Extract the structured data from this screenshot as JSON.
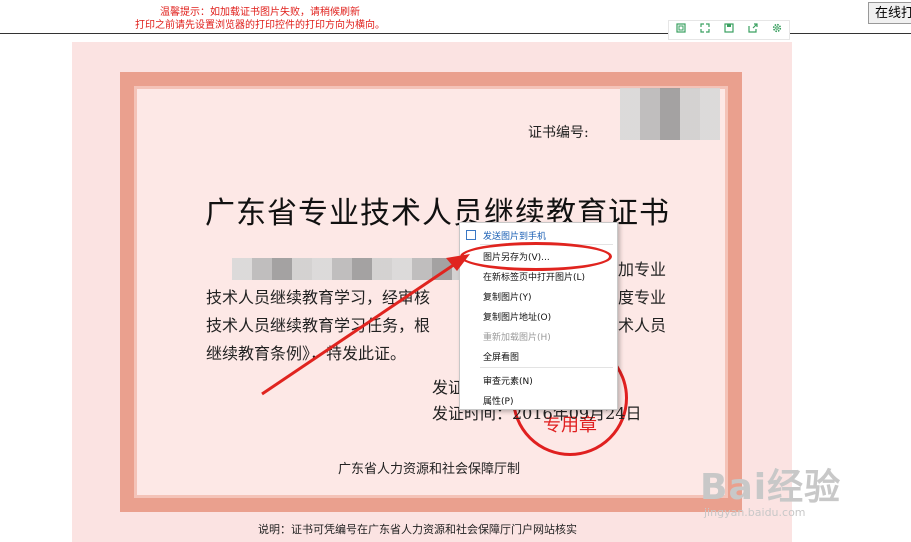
{
  "notice": {
    "line1": "温馨提示：如加载证书图片失败，请稍候刷新",
    "line2": "打印之前请先设置浏览器的打印控件的打印方向为横向。"
  },
  "online_button": "在线打",
  "toolbar": {
    "icons": [
      "fit-icon",
      "fullscreen-icon",
      "save-icon",
      "share-icon",
      "gear-icon"
    ]
  },
  "certificate": {
    "number_label": "证书编号:",
    "title": "广东省专业技术人员继续教育证书",
    "line1_suffix": "加专业",
    "line2_left": "技术人员继续教育学习，经审核",
    "line2_right": "度专业",
    "line3_left": "技术人员继续教育学习任务，根",
    "line3_right": "术人员",
    "line4": "继续教育条例》，特发此证。",
    "issue_unit_fragment": "发证",
    "issue_date": "发证时间：2016年09月24日",
    "stamp_text": "专用章",
    "issuer": "广东省人力资源和社会保障厅制",
    "note": "说明：证书可凭编号在广东省人力资源和社会保障厅门户网站核实"
  },
  "context_menu": {
    "items": [
      {
        "label": "发送图片到手机",
        "style": "blue"
      },
      {
        "label": "图片另存为(V)...",
        "style": "normal"
      },
      {
        "label": "在新标签页中打开图片(L)",
        "style": "normal"
      },
      {
        "label": "复制图片(Y)",
        "style": "normal"
      },
      {
        "label": "复制图片地址(O)",
        "style": "normal"
      },
      {
        "label": "重新加载图片(H)",
        "style": "disabled"
      },
      {
        "label": "全屏看图",
        "style": "normal"
      },
      {
        "label": "审查元素(N)",
        "style": "normal"
      },
      {
        "label": "属性(P)",
        "style": "normal"
      }
    ]
  },
  "watermark": {
    "brand": "Bai经验",
    "domain": "jingyan.baidu.com"
  },
  "colors": {
    "notice_red": "#e0201c",
    "border_salmon": "#eaa08e",
    "cert_bg": "#fbe3e2",
    "annotation_red": "#e0241f",
    "toolbar_green": "#3aa060"
  }
}
